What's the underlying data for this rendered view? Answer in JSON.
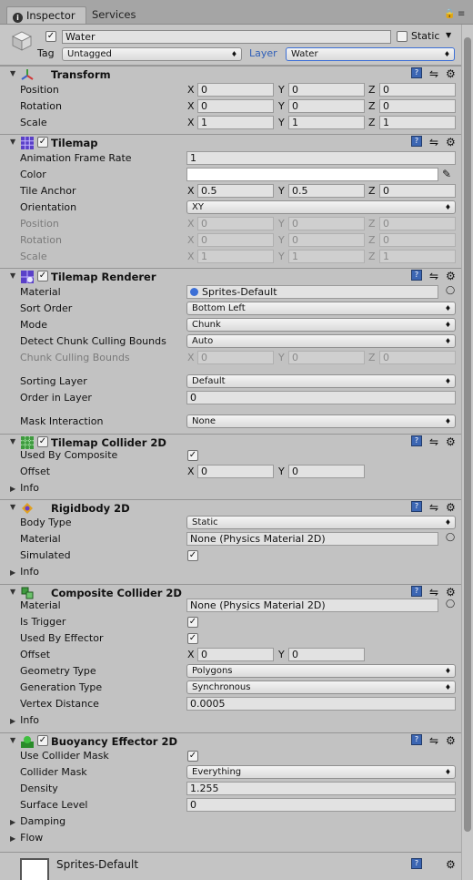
{
  "tabs": [
    {
      "label": "Inspector"
    },
    {
      "label": "Services"
    }
  ],
  "object": {
    "name": "Water",
    "static_label": "Static",
    "tag_label": "Tag",
    "tag_value": "Untagged",
    "layer_label": "Layer",
    "layer_value": "Water"
  },
  "components": [
    {
      "title": "Transform",
      "rows": [
        {
          "label": "Position",
          "vec": [
            "0",
            "0",
            "0"
          ]
        },
        {
          "label": "Rotation",
          "vec": [
            "0",
            "0",
            "0"
          ]
        },
        {
          "label": "Scale",
          "vec": [
            "1",
            "1",
            "1"
          ]
        }
      ]
    },
    {
      "title": "Tilemap",
      "rows": [
        {
          "label": "Animation Frame Rate",
          "value": "1"
        },
        {
          "label": "Color"
        },
        {
          "label": "Tile Anchor",
          "vec": [
            "0.5",
            "0.5",
            "0"
          ]
        },
        {
          "label": "Orientation",
          "value": "XY"
        },
        {
          "label": "Position",
          "vec": [
            "0",
            "0",
            "0"
          ]
        },
        {
          "label": "Rotation",
          "vec": [
            "0",
            "0",
            "0"
          ]
        },
        {
          "label": "Scale",
          "vec": [
            "1",
            "1",
            "1"
          ]
        }
      ]
    },
    {
      "title": "Tilemap Renderer",
      "rows": [
        {
          "label": "Material",
          "value": "Sprites-Default"
        },
        {
          "label": "Sort Order",
          "value": "Bottom Left"
        },
        {
          "label": "Mode",
          "value": "Chunk"
        },
        {
          "label": "Detect Chunk Culling Bounds",
          "value": "Auto"
        },
        {
          "label": "Chunk Culling Bounds",
          "vec": [
            "0",
            "0",
            "0"
          ]
        },
        {
          "label": "Sorting Layer",
          "value": "Default"
        },
        {
          "label": "Order in Layer",
          "value": "0"
        },
        {
          "label": "Mask Interaction",
          "value": "None"
        }
      ]
    },
    {
      "title": "Tilemap Collider 2D",
      "rows": [
        {
          "label": "Used By Composite"
        },
        {
          "label": "Offset",
          "vec": [
            "0",
            "0"
          ]
        },
        {
          "label": "Info"
        }
      ]
    },
    {
      "title": "Rigidbody 2D",
      "rows": [
        {
          "label": "Body Type",
          "value": "Static"
        },
        {
          "label": "Material",
          "value": "None (Physics Material 2D)"
        },
        {
          "label": "Simulated"
        },
        {
          "label": "Info"
        }
      ]
    },
    {
      "title": "Composite Collider 2D",
      "rows": [
        {
          "label": "Material",
          "value": "None (Physics Material 2D)"
        },
        {
          "label": "Is Trigger"
        },
        {
          "label": "Used By Effector"
        },
        {
          "label": "Offset",
          "vec": [
            "0",
            "0"
          ]
        },
        {
          "label": "Geometry Type",
          "value": "Polygons"
        },
        {
          "label": "Generation Type",
          "value": "Synchronous"
        },
        {
          "label": "Vertex Distance",
          "value": "0.0005"
        },
        {
          "label": "Info"
        }
      ]
    },
    {
      "title": "Buoyancy Effector 2D",
      "rows": [
        {
          "label": "Use Collider Mask"
        },
        {
          "label": "Collider Mask",
          "value": "Everything"
        },
        {
          "label": "Density",
          "value": "1.255"
        },
        {
          "label": "Surface Level",
          "value": "0"
        },
        {
          "label": "Damping"
        },
        {
          "label": "Flow"
        }
      ]
    }
  ],
  "axis": {
    "x": "X",
    "y": "Y",
    "z": "Z"
  },
  "bottom_material": {
    "title": "Sprites-Default"
  },
  "colors": {
    "panel": "#c2c2c2",
    "field": "#e2e2e2",
    "accent": "#3c6fd6"
  }
}
